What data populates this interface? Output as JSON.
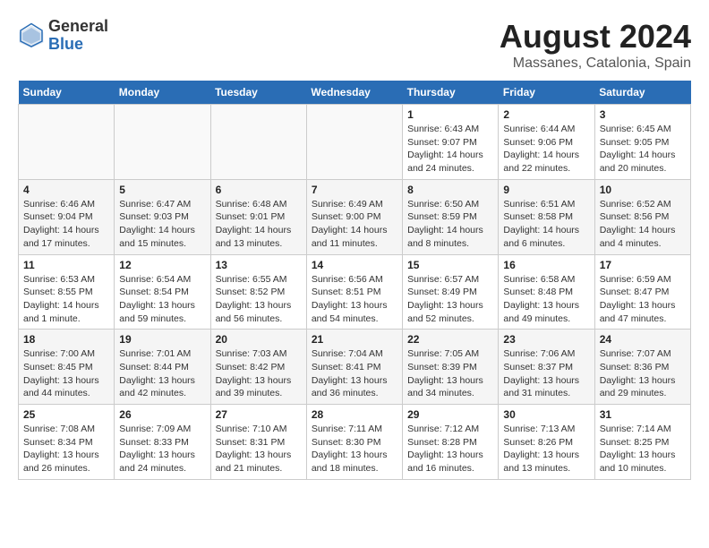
{
  "header": {
    "logo_general": "General",
    "logo_blue": "Blue",
    "month_year": "August 2024",
    "location": "Massanes, Catalonia, Spain"
  },
  "days_of_week": [
    "Sunday",
    "Monday",
    "Tuesday",
    "Wednesday",
    "Thursday",
    "Friday",
    "Saturday"
  ],
  "weeks": [
    [
      {
        "day": "",
        "info": ""
      },
      {
        "day": "",
        "info": ""
      },
      {
        "day": "",
        "info": ""
      },
      {
        "day": "",
        "info": ""
      },
      {
        "day": "1",
        "info": "Sunrise: 6:43 AM\nSunset: 9:07 PM\nDaylight: 14 hours\nand 24 minutes."
      },
      {
        "day": "2",
        "info": "Sunrise: 6:44 AM\nSunset: 9:06 PM\nDaylight: 14 hours\nand 22 minutes."
      },
      {
        "day": "3",
        "info": "Sunrise: 6:45 AM\nSunset: 9:05 PM\nDaylight: 14 hours\nand 20 minutes."
      }
    ],
    [
      {
        "day": "4",
        "info": "Sunrise: 6:46 AM\nSunset: 9:04 PM\nDaylight: 14 hours\nand 17 minutes."
      },
      {
        "day": "5",
        "info": "Sunrise: 6:47 AM\nSunset: 9:03 PM\nDaylight: 14 hours\nand 15 minutes."
      },
      {
        "day": "6",
        "info": "Sunrise: 6:48 AM\nSunset: 9:01 PM\nDaylight: 14 hours\nand 13 minutes."
      },
      {
        "day": "7",
        "info": "Sunrise: 6:49 AM\nSunset: 9:00 PM\nDaylight: 14 hours\nand 11 minutes."
      },
      {
        "day": "8",
        "info": "Sunrise: 6:50 AM\nSunset: 8:59 PM\nDaylight: 14 hours\nand 8 minutes."
      },
      {
        "day": "9",
        "info": "Sunrise: 6:51 AM\nSunset: 8:58 PM\nDaylight: 14 hours\nand 6 minutes."
      },
      {
        "day": "10",
        "info": "Sunrise: 6:52 AM\nSunset: 8:56 PM\nDaylight: 14 hours\nand 4 minutes."
      }
    ],
    [
      {
        "day": "11",
        "info": "Sunrise: 6:53 AM\nSunset: 8:55 PM\nDaylight: 14 hours\nand 1 minute."
      },
      {
        "day": "12",
        "info": "Sunrise: 6:54 AM\nSunset: 8:54 PM\nDaylight: 13 hours\nand 59 minutes."
      },
      {
        "day": "13",
        "info": "Sunrise: 6:55 AM\nSunset: 8:52 PM\nDaylight: 13 hours\nand 56 minutes."
      },
      {
        "day": "14",
        "info": "Sunrise: 6:56 AM\nSunset: 8:51 PM\nDaylight: 13 hours\nand 54 minutes."
      },
      {
        "day": "15",
        "info": "Sunrise: 6:57 AM\nSunset: 8:49 PM\nDaylight: 13 hours\nand 52 minutes."
      },
      {
        "day": "16",
        "info": "Sunrise: 6:58 AM\nSunset: 8:48 PM\nDaylight: 13 hours\nand 49 minutes."
      },
      {
        "day": "17",
        "info": "Sunrise: 6:59 AM\nSunset: 8:47 PM\nDaylight: 13 hours\nand 47 minutes."
      }
    ],
    [
      {
        "day": "18",
        "info": "Sunrise: 7:00 AM\nSunset: 8:45 PM\nDaylight: 13 hours\nand 44 minutes."
      },
      {
        "day": "19",
        "info": "Sunrise: 7:01 AM\nSunset: 8:44 PM\nDaylight: 13 hours\nand 42 minutes."
      },
      {
        "day": "20",
        "info": "Sunrise: 7:03 AM\nSunset: 8:42 PM\nDaylight: 13 hours\nand 39 minutes."
      },
      {
        "day": "21",
        "info": "Sunrise: 7:04 AM\nSunset: 8:41 PM\nDaylight: 13 hours\nand 36 minutes."
      },
      {
        "day": "22",
        "info": "Sunrise: 7:05 AM\nSunset: 8:39 PM\nDaylight: 13 hours\nand 34 minutes."
      },
      {
        "day": "23",
        "info": "Sunrise: 7:06 AM\nSunset: 8:37 PM\nDaylight: 13 hours\nand 31 minutes."
      },
      {
        "day": "24",
        "info": "Sunrise: 7:07 AM\nSunset: 8:36 PM\nDaylight: 13 hours\nand 29 minutes."
      }
    ],
    [
      {
        "day": "25",
        "info": "Sunrise: 7:08 AM\nSunset: 8:34 PM\nDaylight: 13 hours\nand 26 minutes."
      },
      {
        "day": "26",
        "info": "Sunrise: 7:09 AM\nSunset: 8:33 PM\nDaylight: 13 hours\nand 24 minutes."
      },
      {
        "day": "27",
        "info": "Sunrise: 7:10 AM\nSunset: 8:31 PM\nDaylight: 13 hours\nand 21 minutes."
      },
      {
        "day": "28",
        "info": "Sunrise: 7:11 AM\nSunset: 8:30 PM\nDaylight: 13 hours\nand 18 minutes."
      },
      {
        "day": "29",
        "info": "Sunrise: 7:12 AM\nSunset: 8:28 PM\nDaylight: 13 hours\nand 16 minutes."
      },
      {
        "day": "30",
        "info": "Sunrise: 7:13 AM\nSunset: 8:26 PM\nDaylight: 13 hours\nand 13 minutes."
      },
      {
        "day": "31",
        "info": "Sunrise: 7:14 AM\nSunset: 8:25 PM\nDaylight: 13 hours\nand 10 minutes."
      }
    ]
  ]
}
